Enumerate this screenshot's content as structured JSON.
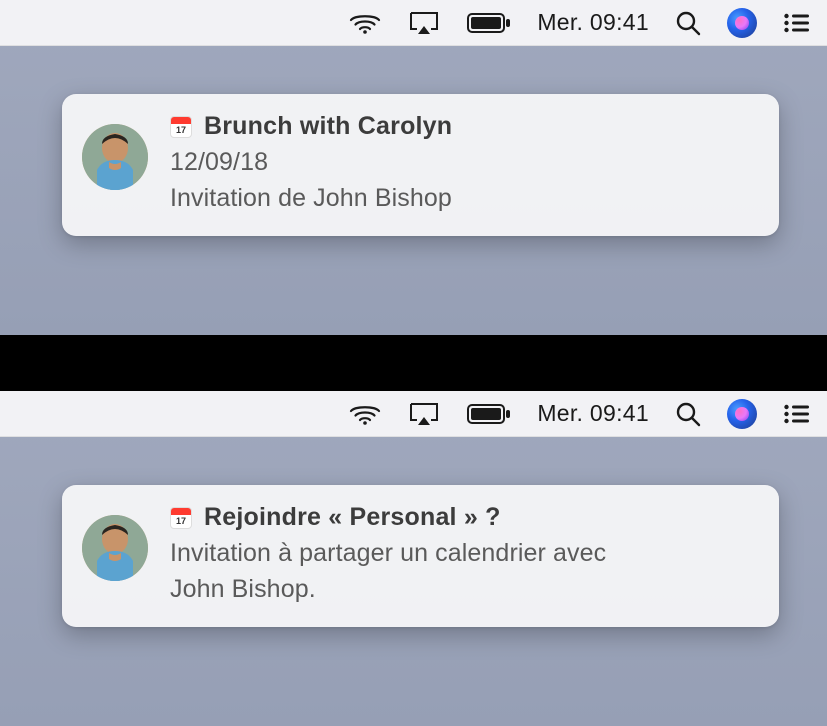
{
  "menubar": {
    "datetime": "Mer. 09:41"
  },
  "notifications": {
    "top": {
      "title": "Brunch with Carolyn",
      "date": "12/09/18",
      "line2": "Invitation de John Bishop"
    },
    "bottom": {
      "title": "Rejoindre « Personal » ?",
      "line1": "Invitation à partager un calendrier avec",
      "line2": "John Bishop."
    }
  }
}
